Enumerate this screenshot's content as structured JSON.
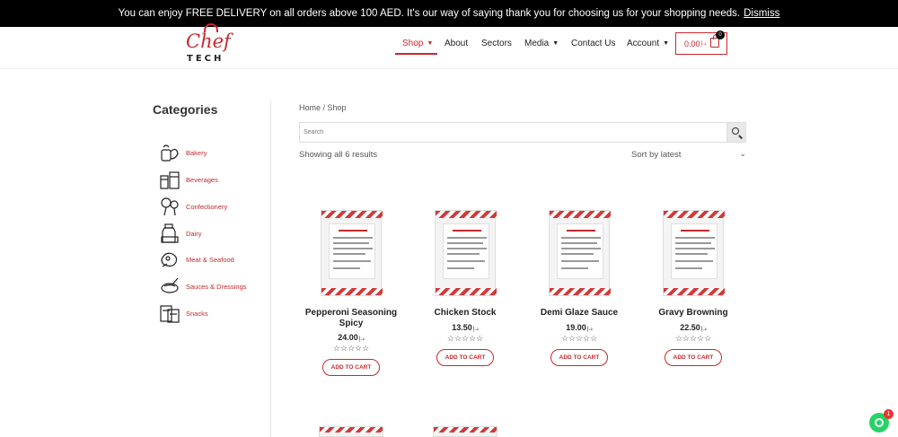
{
  "announcement": {
    "text": "You can enjoy FREE DELIVERY on all orders above 100 AED. It's our way of saying thank you for choosing us for your shopping needs.",
    "dismiss_label": "Dismiss"
  },
  "brand": {
    "logo_top": "Chef",
    "logo_bottom": "TECH"
  },
  "nav": {
    "items": [
      {
        "label": "Shop",
        "active": true,
        "has_dropdown": true
      },
      {
        "label": "About"
      },
      {
        "label": "Sectors"
      },
      {
        "label": "Media",
        "has_dropdown": true
      },
      {
        "label": "Contact Us"
      },
      {
        "label": "Account",
        "has_dropdown": true
      }
    ],
    "cart_total": "0.00",
    "cart_currency": "د.إ",
    "cart_count": "0"
  },
  "sidebar": {
    "title": "Categories",
    "categories": [
      {
        "label": "Bakery",
        "icon": "bakery-icon"
      },
      {
        "label": "Beverages",
        "icon": "beverages-icon"
      },
      {
        "label": "Confectionery",
        "icon": "confectionery-icon"
      },
      {
        "label": "Dairy",
        "icon": "dairy-icon"
      },
      {
        "label": "Meat & Seafood",
        "icon": "meat-seafood-icon"
      },
      {
        "label": "Sauces & Dressings",
        "icon": "sauces-icon"
      },
      {
        "label": "Snacks",
        "icon": "snacks-icon"
      }
    ]
  },
  "shop": {
    "breadcrumb_home": "Home",
    "breadcrumb_sep": " / ",
    "breadcrumb_current": "Shop",
    "search_placeholder": "Search",
    "results_text": "Showing all 6 results",
    "sort_label": "Sort by latest",
    "add_to_cart_label": "ADD TO CART",
    "currency": "د.إ",
    "products": [
      {
        "name": "Pepperoni Seasoning Spicy",
        "price": "24.00",
        "rating": 0
      },
      {
        "name": "Chicken Stock",
        "price": "13.50",
        "rating": 0
      },
      {
        "name": "Demi Glaze Sauce",
        "price": "19.00",
        "rating": 0
      },
      {
        "name": "Gravy Browning",
        "price": "22.50",
        "rating": 0
      }
    ]
  },
  "whatsapp": {
    "badge_count": "1"
  },
  "colors": {
    "accent": "#c8282c",
    "topbar": "#000000",
    "whatsapp": "#25d366"
  }
}
